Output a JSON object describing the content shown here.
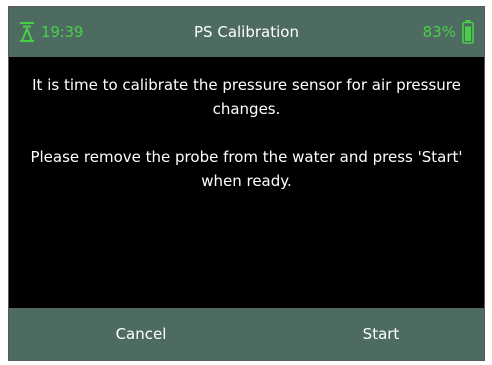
{
  "status_bar": {
    "signal_icon": "signal-tower-icon",
    "time": "19:39",
    "title": "PS Calibration",
    "battery_percent": "83%",
    "battery_icon": "battery-icon",
    "accent_color": "#47d046",
    "bar_color": "#4e6b62"
  },
  "message": {
    "paragraph_1": "It is time to calibrate the pressure sensor for air pressure changes.",
    "paragraph_2": "Please remove the probe from the water and press 'Start' when ready."
  },
  "softkeys": {
    "left_label": "Cancel",
    "right_label": "Start"
  }
}
